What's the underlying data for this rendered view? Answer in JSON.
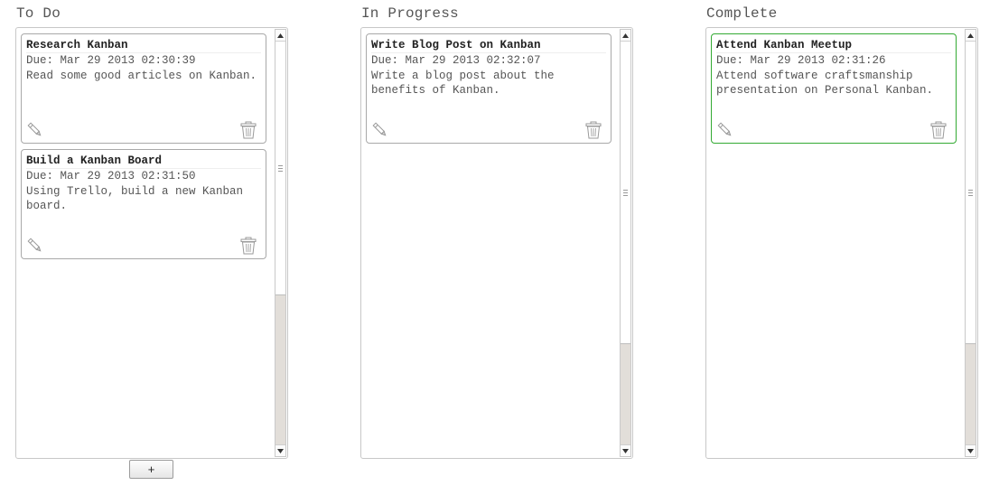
{
  "columns": [
    {
      "id": "todo",
      "title": "To Do",
      "cards": [
        {
          "title": "Research Kanban",
          "due": "Due: Mar 29 2013 02:30:39",
          "description": "Read some good articles on Kanban."
        },
        {
          "title": "Build a Kanban Board",
          "due": "Due: Mar 29 2013 02:31:50",
          "description": "Using Trello, build a new Kanban board."
        }
      ]
    },
    {
      "id": "in-progress",
      "title": "In Progress",
      "cards": [
        {
          "title": "Write Blog Post on Kanban",
          "due": "Due: Mar 29 2013 02:32:07",
          "description": "Write a blog post about the benefits of Kanban."
        }
      ]
    },
    {
      "id": "complete",
      "title": "Complete",
      "cards": [
        {
          "title": "Attend Kanban Meetup",
          "due": "Due: Mar 29 2013 02:31:26",
          "description": "Attend software craftsmanship presentation on Personal Kanban."
        }
      ]
    }
  ],
  "add_button_label": "+",
  "icons": {
    "edit": "pencil-icon",
    "delete": "trash-icon"
  },
  "colors": {
    "complete_card_border": "#33aa33",
    "card_border": "#a9a9a9"
  }
}
